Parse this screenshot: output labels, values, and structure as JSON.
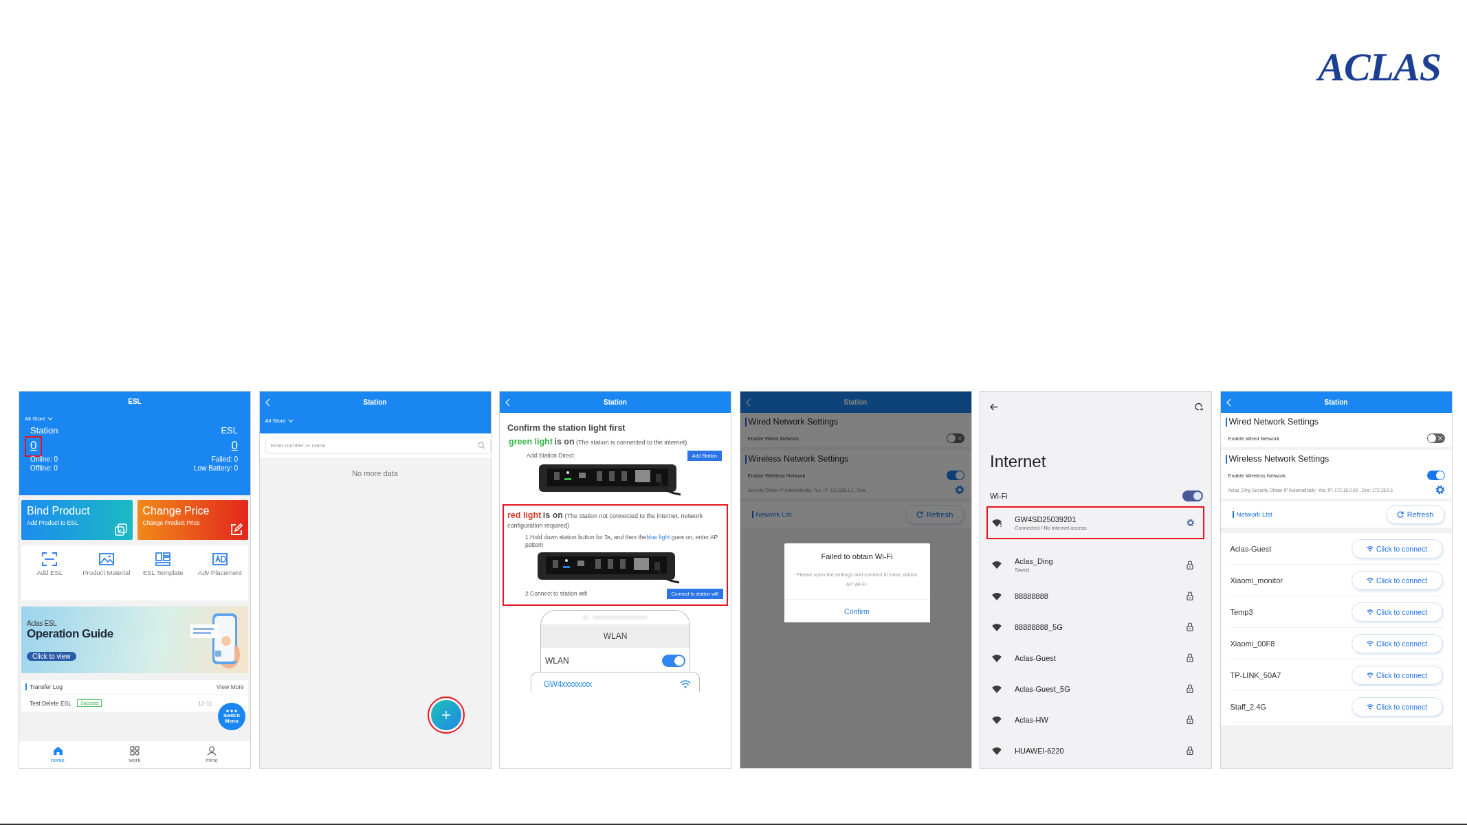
{
  "logo": {
    "text": "ACLAS"
  },
  "screens": [
    {
      "kind": "home",
      "title": "ESL",
      "store": "All Store",
      "stats": [
        {
          "label": "Station",
          "count": "0",
          "lines": [
            "Online: 0",
            "Offline: 0"
          ],
          "highlighted": true
        },
        {
          "label": "ESL",
          "count": "0",
          "lines": [
            "Failed: 0",
            "Low Battery: 0"
          ],
          "highlighted": false
        }
      ],
      "cards": [
        {
          "kind": "bind",
          "title": "Bind Product",
          "subtitle": "Add Product to ESL"
        },
        {
          "kind": "price",
          "title": "Change Price",
          "subtitle": "Change Product Price"
        }
      ],
      "shortcuts": [
        {
          "kind": "scan",
          "label": "Add ESL"
        },
        {
          "kind": "image",
          "label": "Product Material"
        },
        {
          "kind": "template",
          "label": "ESL Template"
        },
        {
          "kind": "ad",
          "label": "Adv Placement"
        }
      ],
      "banner": {
        "brand": "Aclas ESL",
        "title": "Operation Guide",
        "button": "Click to view"
      },
      "log": {
        "title": "Transfer Log",
        "more": "View More",
        "rows": [
          {
            "name": "Test  Delete ESL",
            "status": "Success",
            "time": "12-11"
          }
        ]
      },
      "fab": {
        "label": "Switch Menu"
      },
      "nav": [
        {
          "kind": "home",
          "label": "home",
          "selected": true
        },
        {
          "kind": "work",
          "label": "work",
          "selected": false
        },
        {
          "kind": "mine",
          "label": "mine",
          "selected": false
        }
      ]
    },
    {
      "kind": "station_list",
      "title": "Station",
      "store": "All Store",
      "search": {
        "placeholder": "Enter number or name"
      },
      "empty": "No more data",
      "fab": {
        "highlighted": true
      }
    },
    {
      "kind": "guide",
      "title": "Station",
      "heading": "Confirm the station light first",
      "sections": [
        {
          "light": "green light",
          "state": "is on",
          "note": "(The station is connected to the internet)",
          "color": "#3cb44a",
          "highlighted": false,
          "items": [
            {
              "kind": "step",
              "text": "Add Station Direct",
              "button": "Add Station"
            },
            {
              "kind": "device",
              "color": "#35c24a"
            }
          ]
        },
        {
          "light": "red light",
          "state": "is on",
          "note": "(The station not connected to the internet, network configuration required)",
          "color": "#d63c2c",
          "highlighted": true,
          "items": [
            {
              "kind": "step",
              "text": "1.Hold down station button for 3s, and then the",
              "accent": "blue light",
              "after": "goes on, enter AP pattern"
            },
            {
              "kind": "device",
              "color": "#2f7fe0"
            },
            {
              "kind": "step",
              "text": "2.Connect to station wifi",
              "button": "Connect to station wifi"
            }
          ]
        }
      ],
      "phone": {
        "title": "WLAN",
        "label": "WLAN",
        "on": true,
        "network": "GW4xxxxxxxx"
      }
    },
    {
      "kind": "network_settings",
      "title": "Station",
      "sections": [
        {
          "title": "Wired Network Settings",
          "toggle_label": "Enable Wired Network",
          "on": false
        },
        {
          "title": "Wireless Network Settings",
          "toggle_label": "Enable Wireless Network",
          "on": true,
          "info": "Security Obtain IP Automatically:  Yes, IP: 192.168.1.1 , Dns:"
        }
      ],
      "list": {
        "title": "Network List",
        "refresh": "Refresh"
      },
      "dialog": {
        "title": "Failed to obtain Wi-Fi",
        "message": "Please open the settings and connect to base station AP Wi-Fi.",
        "button": "Confirm"
      }
    },
    {
      "kind": "android_wifi",
      "title": "Internet",
      "wifi": {
        "label": "Wi-Fi",
        "on": true
      },
      "networks": [
        {
          "name": "GW4SD25039201",
          "status": "Connected / No internet access",
          "kind": "gear",
          "warning": true,
          "highlighted": true
        },
        {
          "name": "Aclas_Ding",
          "status": "Saved",
          "kind": "lock",
          "warning": false,
          "highlighted": false
        },
        {
          "name": "88888888",
          "kind": "lock",
          "warning": false,
          "highlighted": false
        },
        {
          "name": "88888888_5G",
          "kind": "lock",
          "warning": false,
          "highlighted": false
        },
        {
          "name": "Aclas-Guest",
          "kind": "lock",
          "warning": false,
          "highlighted": false
        },
        {
          "name": "Aclas-Guest_5G",
          "kind": "lock",
          "warning": false,
          "highlighted": false
        },
        {
          "name": "Aclas-HW",
          "kind": "lock",
          "warning": false,
          "highlighted": false
        },
        {
          "name": "HUAWEI-6220",
          "kind": "lock",
          "warning": false,
          "highlighted": false
        }
      ]
    },
    {
      "kind": "network_settings",
      "title": "Station",
      "sections": [
        {
          "title": "Wired Network Settings",
          "toggle_label": "Enable Wired Network",
          "on": false
        },
        {
          "title": "Wireless Network Settings",
          "toggle_label": "Enable Wireless Network",
          "on": true,
          "info": "Aclas_Ding Security Obtain IP Automatically:  Yes, IP: 172.18.0.99 , Dns: 172.18.0.1"
        }
      ],
      "list": {
        "title": "Network List",
        "refresh": "Refresh"
      },
      "networks": [
        {
          "name": "Aclas-Guest",
          "action": "Click to connect"
        },
        {
          "name": "Xiaomi_monitor",
          "action": "Click to connect"
        },
        {
          "name": "Temp3",
          "action": "Click to connect"
        },
        {
          "name": "Xiaomi_00F8",
          "action": "Click to connect"
        },
        {
          "name": "TP-LINK_50A7",
          "action": "Click to connect"
        },
        {
          "name": "Staff_2.4G",
          "action": "Click to connect"
        }
      ]
    }
  ]
}
